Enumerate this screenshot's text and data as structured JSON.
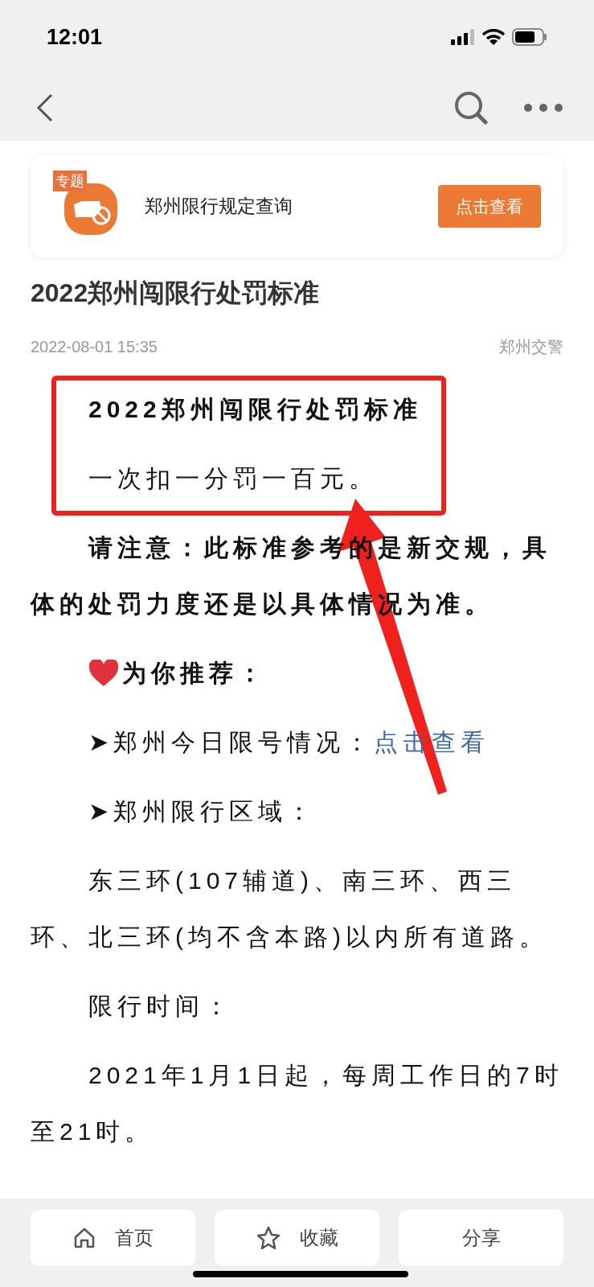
{
  "status_bar": {
    "time": "12:01"
  },
  "topic_card": {
    "badge": "专题",
    "title": "郑州限行规定查询",
    "button": "点击查看"
  },
  "article": {
    "title": "2022郑州闯限行处罚标准",
    "date": "2022-08-01 15:35",
    "source": "郑州交警",
    "paragraphs": [
      {
        "kind": "text",
        "bold": true,
        "text": "2022郑州闯限行处罚标准"
      },
      {
        "kind": "text",
        "bold": false,
        "text": "一次扣一分罚一百元。"
      },
      {
        "kind": "text",
        "bold": true,
        "text": "请注意：此标准参考的是新交规，具体的处罚力度还是以具体情况为准。"
      },
      {
        "kind": "heart_heading",
        "bold": true,
        "text": "为你推荐："
      },
      {
        "kind": "link_line",
        "bold": false,
        "text": "➤郑州今日限号情况：",
        "link": "点击查看"
      },
      {
        "kind": "text",
        "bold": false,
        "text": "➤郑州限行区域："
      },
      {
        "kind": "text",
        "bold": false,
        "text": "东三环(107辅道)、南三环、西三环、北三环(均不含本路)以内所有道路。"
      },
      {
        "kind": "text",
        "bold": false,
        "text": "限行时间："
      },
      {
        "kind": "text",
        "bold": false,
        "text": "2021年1月1日起，每周工作日的7时至21时。"
      }
    ]
  },
  "bottom_bar": [
    {
      "kind": "home",
      "label": "首页"
    },
    {
      "kind": "star",
      "label": "收藏"
    },
    {
      "kind": "share",
      "label": "分享"
    }
  ]
}
